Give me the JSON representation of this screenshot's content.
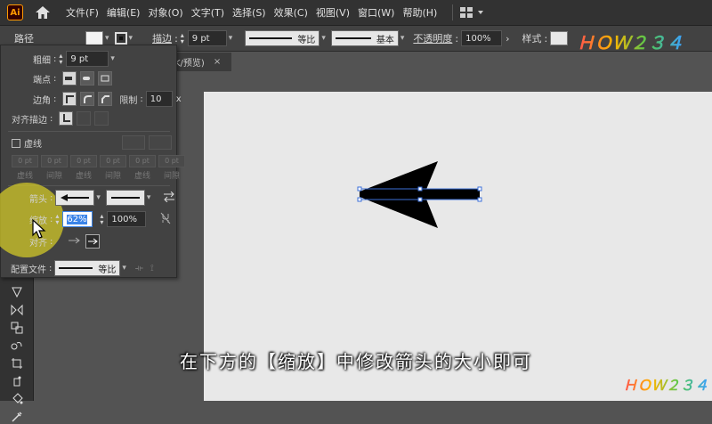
{
  "app": {
    "logo": "Ai"
  },
  "menu": [
    "文件(F)",
    "编辑(E)",
    "对象(O)",
    "文字(T)",
    "选择(S)",
    "效果(C)",
    "视图(V)",
    "窗口(W)",
    "帮助(H)"
  ],
  "control": {
    "object_type": "路径",
    "stroke_label": "描边",
    "stroke_weight": "9 pt",
    "profile_label": "等比",
    "brush_label": "基本",
    "opacity_label": "不透明度",
    "opacity_value": "100%",
    "style_label": "样式"
  },
  "doc_tab": {
    "title": "K/预览)",
    "close": "×"
  },
  "stroke_panel": {
    "weight_label": "粗细",
    "weight_value": "9 pt",
    "cap_label": "端点",
    "corner_label": "边角",
    "limit_label": "限制",
    "limit_value": "10",
    "limit_unit": "x",
    "align_label": "对齐描边",
    "dashed_label": "虚线",
    "dash_fields": [
      "0 pt",
      "0 pt",
      "0 pt",
      "0 pt",
      "0 pt",
      "0 pt"
    ],
    "dash_names": [
      "虚线",
      "间隙",
      "虚线",
      "间隙",
      "虚线",
      "间隙"
    ],
    "arrow_label": "箭头",
    "scale_label": "缩放",
    "scale_start": "62%",
    "scale_end": "100%",
    "align_arrow_label": "对齐",
    "profile_label": "配置文件",
    "profile_value": "等比"
  },
  "subtitle": "在下方的【缩放】中修改箭头的大小即可",
  "watermark": "ＨＯＷ２３４",
  "colors": {
    "accent": "#3b84e8",
    "highlight": "#d2c828",
    "canvas": "#e8e8e8"
  }
}
